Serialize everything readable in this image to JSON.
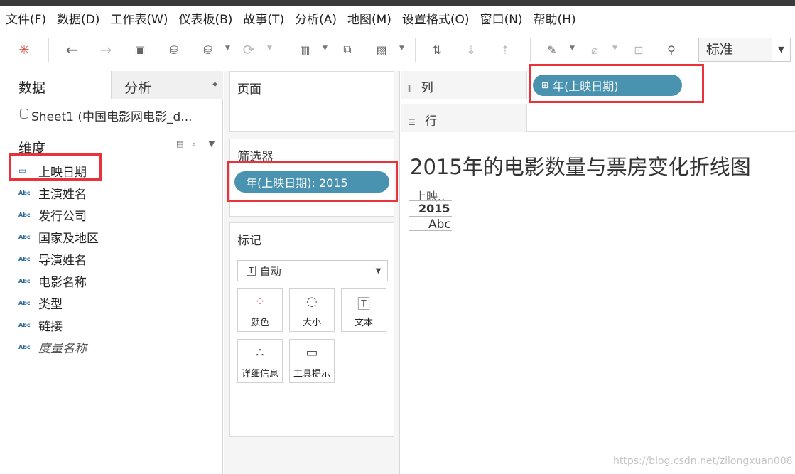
{
  "menu": [
    "文件(F)",
    "数据(D)",
    "工作表(W)",
    "仪表板(B)",
    "故事(T)",
    "分析(A)",
    "地图(M)",
    "设置格式(O)",
    "窗口(N)",
    "帮助(H)"
  ],
  "toolbar": {
    "view_size": "标准"
  },
  "data_pane": {
    "tab_data": "数据",
    "tab_analysis": "分析",
    "source": "Sheet1 (中国电影网电影_d...",
    "dimensions_title": "维度",
    "fields": [
      {
        "label": "上映日期",
        "icon": "calendar-icon"
      },
      {
        "label": "主演姓名",
        "icon": "Abc"
      },
      {
        "label": "发行公司",
        "icon": "Abc"
      },
      {
        "label": "国家及地区",
        "icon": "Abc"
      },
      {
        "label": "导演姓名",
        "icon": "Abc"
      },
      {
        "label": "电影名称",
        "icon": "Abc"
      },
      {
        "label": "类型",
        "icon": "Abc"
      },
      {
        "label": "链接",
        "icon": "Abc"
      },
      {
        "label": "度量名称",
        "icon": "Abc"
      }
    ]
  },
  "shelves": {
    "pages": "页面",
    "filters": "筛选器",
    "filter_pill": "年(上映日期): 2015",
    "marks": "标记",
    "mark_type": "自动",
    "mark_buttons": [
      "颜色",
      "大小",
      "文本",
      "详细信息",
      "工具提示"
    ],
    "columns": "列",
    "rows": "行",
    "column_pill": "年(上映日期)"
  },
  "view": {
    "title": "2015年的电影数量与票房变化折线图",
    "header": "上映..",
    "year": "2015",
    "cell": "Abc"
  },
  "watermark": "https://blog.csdn.net/zilongxuan008",
  "colors": {
    "pill": "#4a93b0",
    "highlight": "#e8333a"
  }
}
